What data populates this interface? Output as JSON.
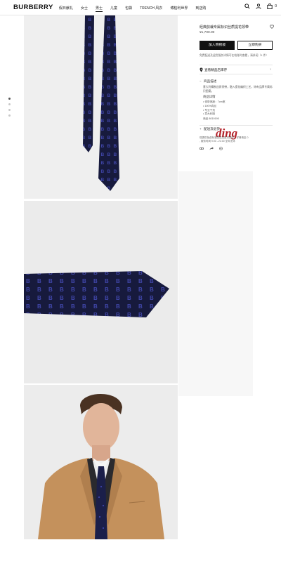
{
  "header": {
    "logo": "BURBERRY",
    "nav": [
      {
        "label": "假日献礼",
        "active": false
      },
      {
        "label": "女士",
        "active": false
      },
      {
        "label": "男士",
        "active": true
      },
      {
        "label": "儿童",
        "active": false
      },
      {
        "label": "包袋",
        "active": false
      },
      {
        "label": "TRENCH 风衣",
        "active": false
      },
      {
        "label": "博柏利世界",
        "active": false
      },
      {
        "label": "到店购",
        "active": false
      }
    ],
    "cart_count": "0",
    "icons": [
      "search-icon",
      "account-icon",
      "shopping-bag-icon"
    ]
  },
  "gallery": {
    "dots": 4,
    "active_dot": 0
  },
  "product": {
    "title": "经典剪裁专属标识丝质提花领带",
    "price": "¥1,700.00",
    "add_to_bag": "加入购物袋",
    "buy_now": "立即购买",
    "note": "免费配送及退货服务详情可在结账时查看，请参阅（1 件）",
    "store_label": "查看精品店库存",
    "sections": {
      "info_title": "商品描述",
      "info_text": "意大利精制丝质领带，融入提花编织工艺，饰有品牌专属标识图案。",
      "detail_title": "商品详情",
      "bullets": [
        "领带宽度：7cm宽",
        "100%真丝",
        "专业干洗",
        "意大利制"
      ],
      "code": "商品 8019190",
      "delivery_title": "配送及退货",
      "watermark": "ding",
      "service_lines": [
        "现提供免费标准配送及退货服务，详情请至 0",
        ", 服务时间 9:00 - 21:00 全年无休"
      ]
    },
    "share_icons": [
      "link-icon",
      "share-icon",
      "mail-icon"
    ]
  },
  "colors": {
    "black": "#111111",
    "navy_tie": "#171a3d",
    "tie_motif": "#3f45a8",
    "watermark_red": "#b32028",
    "camel": "#c4915c"
  }
}
